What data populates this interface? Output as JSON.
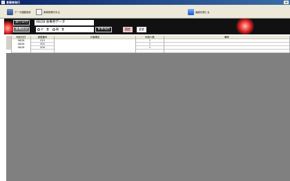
{
  "window": {
    "title": "食事券発行",
    "close_label": "×"
  },
  "toolbar": {
    "db_button": "データ連動保存",
    "list_button": "食事券発行中止",
    "close_button": "画面を閉じる"
  },
  "filters": {
    "date_label": "発行日付",
    "date_value": "08/28 食事券データ",
    "meal_label": "食事区分",
    "meals": [
      {
        "label": "夕　食",
        "selected": false
      },
      {
        "label": "朝　食",
        "selected": false
      }
    ],
    "place_label": "食事場所",
    "fixed_label": "固定",
    "change_label": "変更"
  },
  "table": {
    "headers": [
      "",
      "利用日付",
      "部屋番号",
      "お客様名",
      "利用人数",
      "備考"
    ],
    "rows": [
      {
        "date": "08/28",
        "room": "015",
        "name": "",
        "count": "1",
        "note": ""
      },
      {
        "date": "08/28",
        "room": "005",
        "name": "",
        "count": "1",
        "note": ""
      },
      {
        "date": "08/28",
        "room": "006",
        "name": "",
        "count": "1",
        "note": ""
      }
    ]
  }
}
